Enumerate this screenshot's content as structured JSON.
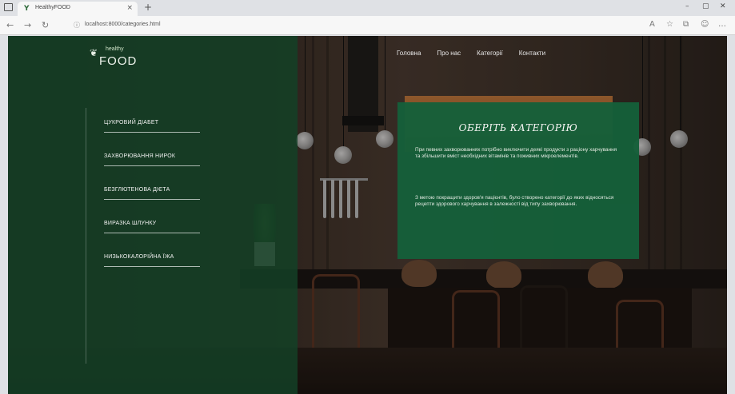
{
  "browser": {
    "tab_title": "HealthyFOOD",
    "tab_favicon": "Y",
    "address": "localhost:8000/categories.html",
    "new_tab_symbol": "+"
  },
  "page": {
    "logo": {
      "small": "healthy",
      "big": "FOOD"
    },
    "nav": [
      "Головна",
      "Про нас",
      "Категорії",
      "Контакти"
    ],
    "side_menu": [
      "ЦУКРОВИЙ ДІАБЕТ",
      "ЗАХВОРЮВАННЯ НИРОК",
      "БЕЗГЛЮТЕНОВА ДІЄТА",
      "ВИРАЗКА ШЛУНКУ",
      "НИЗЬКОКАЛОРІЙНА ЇЖА"
    ],
    "panel": {
      "title": "ОБЕРІТЬ КАТЕГОРІЮ",
      "p1": "При певних захворюваннях потрібно виключити деякі продукти з раціону харчування та збільшити вміст необхідних вітамінів та поживних мікроелементів.",
      "p2": "З метою покращити здоров'я пацієнтів, було створено категорії до яких відносяться рецепти здорового харчування в залежності від типу захворювання."
    }
  },
  "colors": {
    "overlay_green": "#123e24",
    "panel_green": "#15603a",
    "menu_text": "#f2f2f2"
  }
}
